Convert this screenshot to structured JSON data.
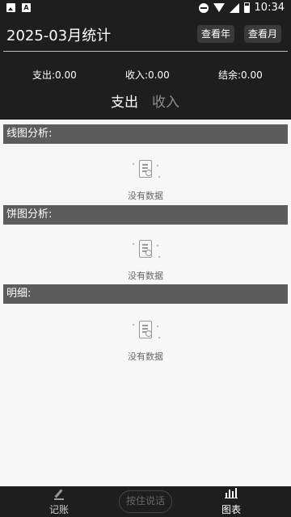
{
  "status_bar": {
    "time": "10:34"
  },
  "header": {
    "title": "2025-03月统计",
    "view_year_label": "查看年",
    "view_month_label": "查看月",
    "summary": {
      "expense": "支出:0.00",
      "income": "收入:0.00",
      "balance": "结余:0.00"
    },
    "tabs": [
      {
        "label": "支出",
        "active": true
      },
      {
        "label": "收入",
        "active": false
      }
    ]
  },
  "sections": [
    {
      "title": "线图分析:",
      "empty_text": "没有数据"
    },
    {
      "title": "饼图分析:",
      "empty_text": "没有数据"
    },
    {
      "title": "明细:",
      "empty_text": "没有数据"
    }
  ],
  "bottom_nav": {
    "record_label": "记账",
    "voice_label": "按住说话",
    "chart_label": "图表"
  },
  "colors": {
    "header_bg": "#1e1e1e",
    "section_bar": "#5c5c5c",
    "inactive_tab": "#8f8f8f"
  }
}
